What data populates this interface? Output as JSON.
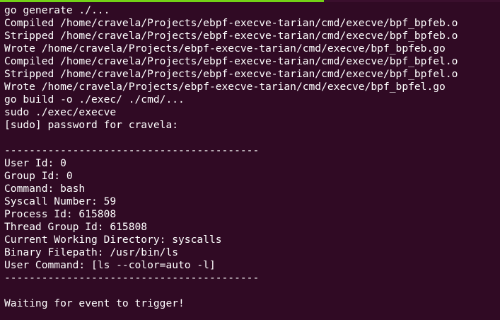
{
  "terminal": {
    "lines": [
      "go generate ./...",
      "Compiled /home/cravela/Projects/ebpf-execve-tarian/cmd/execve/bpf_bpfeb.o",
      "Stripped /home/cravela/Projects/ebpf-execve-tarian/cmd/execve/bpf_bpfeb.o",
      "Wrote /home/cravela/Projects/ebpf-execve-tarian/cmd/execve/bpf_bpfeb.go",
      "Compiled /home/cravela/Projects/ebpf-execve-tarian/cmd/execve/bpf_bpfel.o",
      "Stripped /home/cravela/Projects/ebpf-execve-tarian/cmd/execve/bpf_bpfel.o",
      "Wrote /home/cravela/Projects/ebpf-execve-tarian/cmd/execve/bpf_bpfel.go",
      "go build -o ./exec/ ./cmd/...",
      "sudo ./exec/execve",
      "[sudo] password for cravela:",
      "",
      "-----------------------------------------",
      "User Id: 0",
      "Group Id: 0",
      "Command: bash",
      "Syscall Number: 59",
      "Process Id: 615808",
      "Thread Group Id: 615808",
      "Current Working Directory: syscalls",
      "Binary Filepath: /usr/bin/ls",
      "User Command: [ls --color=auto -l]",
      "-----------------------------------------",
      "",
      "Waiting for event to trigger!"
    ]
  },
  "colors": {
    "background": "#300a24",
    "text": "#ffffff",
    "accent": "#73d216"
  }
}
